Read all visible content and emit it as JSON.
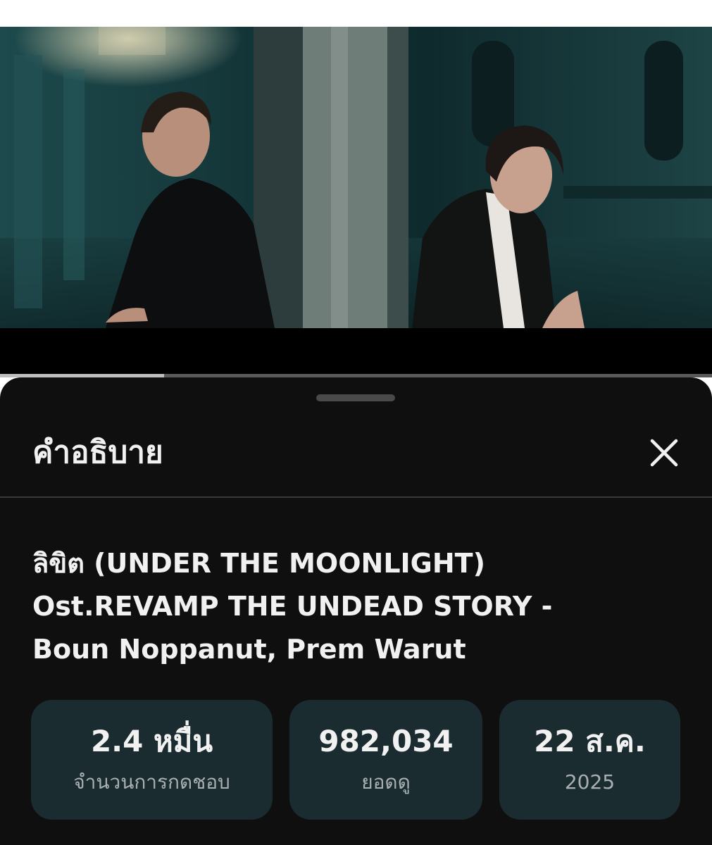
{
  "video": {
    "progress_fraction": 0.23
  },
  "panel": {
    "title": "คำอธิบาย",
    "close_icon": "close-icon"
  },
  "video_info": {
    "title_lines": [
      "ลิขิต (UNDER THE MOONLIGHT)",
      "Ost.REVAMP THE UNDEAD STORY -",
      "Boun Noppanut, Prem Warut"
    ]
  },
  "stats": [
    {
      "value": "2.4 หมื่น",
      "label": "จำนวนการกดชอบ"
    },
    {
      "value": "982,034",
      "label": "ยอดดู"
    },
    {
      "value": "22 ส.ค.",
      "label": "2025"
    }
  ],
  "colors": {
    "sheet_background": "#0f0f0f",
    "card_background": "#1b2c30",
    "text_primary": "#f1f1f1",
    "text_secondary": "#a8b0b2"
  }
}
